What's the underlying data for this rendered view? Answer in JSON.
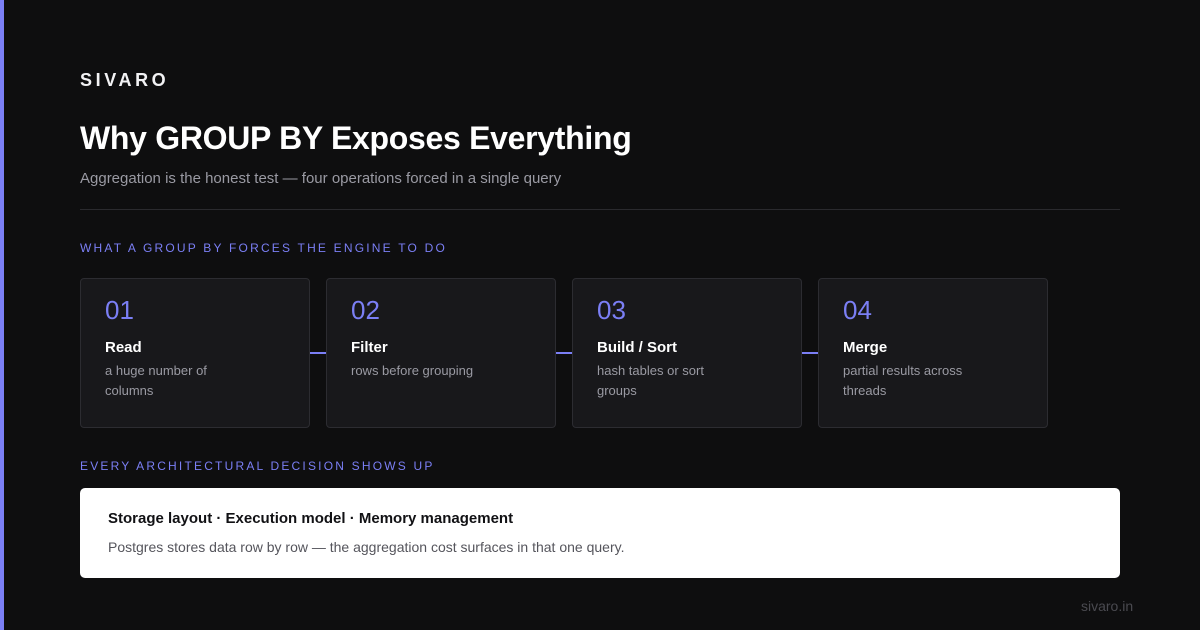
{
  "brand": "SIVARO",
  "title": "Why GROUP BY Exposes Everything",
  "subtitle": "Aggregation is the honest test — four operations forced in a single query",
  "section_1_label": "WHAT A GROUP BY FORCES THE ENGINE TO DO",
  "steps": [
    {
      "num": "01",
      "name": "Read",
      "desc": "a huge number of columns"
    },
    {
      "num": "02",
      "name": "Filter",
      "desc": "rows before grouping"
    },
    {
      "num": "03",
      "name": "Build / Sort",
      "desc": "hash tables or sort groups"
    },
    {
      "num": "04",
      "name": "Merge",
      "desc": "partial results across threads"
    }
  ],
  "section_2_label": "EVERY ARCHITECTURAL DECISION SHOWS UP",
  "callout": {
    "title": "Storage layout · Execution model · Memory management",
    "body": "Postgres stores data row by row — the aggregation cost surfaces in that one query."
  },
  "footer": "sivaro.in",
  "colors": {
    "accent": "#7b7ff5",
    "background": "#0e0e0f",
    "card": "#18181b"
  }
}
